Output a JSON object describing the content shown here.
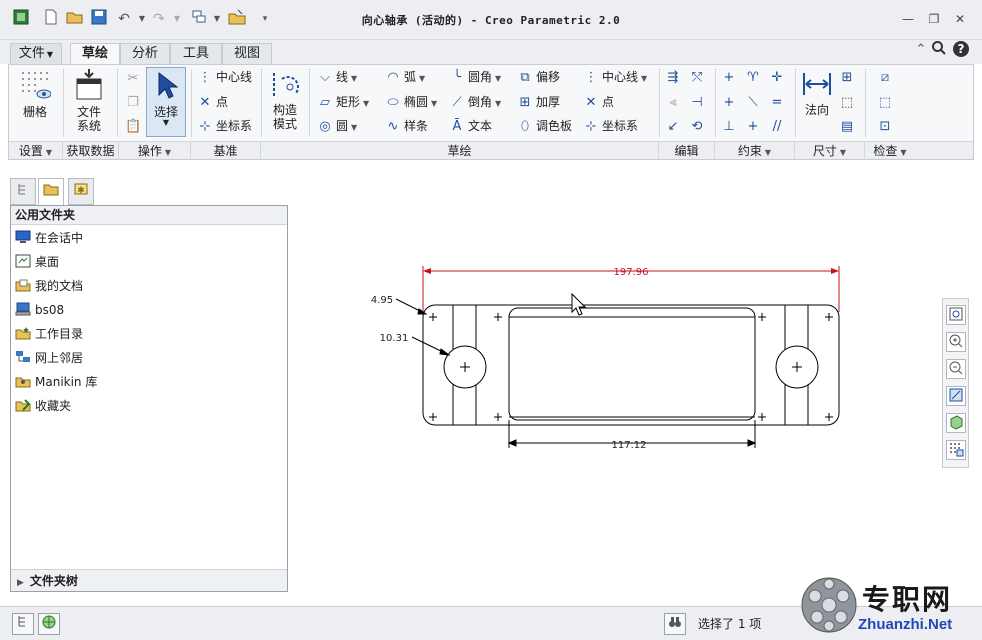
{
  "window": {
    "title": "向心轴承 (活动的) - Creo Parametric 2.0"
  },
  "tabs": [
    {
      "label": "文件",
      "active": false
    },
    {
      "label": "草绘",
      "active": true
    },
    {
      "label": "分析",
      "active": false
    },
    {
      "label": "工具",
      "active": false
    },
    {
      "label": "视图",
      "active": false
    }
  ],
  "ribbon": {
    "grid_label": "栅格",
    "file_system_label": "文件\n系统",
    "select_label": "选择",
    "datum": {
      "centerline": "中心线",
      "point": "点",
      "coordsys": "坐标系"
    },
    "construction_label": "构造\n模式",
    "sketch": {
      "line": "线",
      "rectangle": "矩形",
      "circle": "圆",
      "arc": "弧",
      "ellipse": "椭圆",
      "spline": "样条",
      "fillet": "圆角",
      "chamfer": "倒角",
      "text": "文本",
      "offset": "偏移",
      "thicken": "加厚",
      "palette": "调色板",
      "centerline": "中心线",
      "point": "点",
      "coordsys": "坐标系"
    },
    "normal_label": "法向",
    "groups": {
      "setup": "设置",
      "get_data": "获取数据",
      "operations": "操作",
      "datum": "基准",
      "sketching": "草绘",
      "editing": "编辑",
      "constrain": "约束",
      "dimension": "尺寸",
      "inspect": "检查"
    }
  },
  "navigator": {
    "header": "公用文件夹",
    "folders": [
      {
        "label": "在会话中",
        "icon": "monitor-icon"
      },
      {
        "label": "桌面",
        "icon": "desktop-icon"
      },
      {
        "label": "我的文档",
        "icon": "documents-icon"
      },
      {
        "label": "bs08",
        "icon": "computer-icon"
      },
      {
        "label": "工作目录",
        "icon": "working-dir-icon"
      },
      {
        "label": "网上邻居",
        "icon": "network-icon"
      },
      {
        "label": "Manikin 库",
        "icon": "manikin-icon"
      },
      {
        "label": "收藏夹",
        "icon": "favorites-icon"
      }
    ],
    "folder_tree": "文件夹树"
  },
  "drawing": {
    "dims": {
      "overall_width": "197.96",
      "corner_radius": "4.95",
      "hole_dia": "10.31",
      "slot_width": "117.12"
    }
  },
  "status": {
    "selection": "选择了 1 项"
  },
  "watermark": {
    "cn": "专职网",
    "en": "Zhuanzhi.Net"
  },
  "colors": {
    "ribbon_icon": "#1f4e9e",
    "dimension_red": "#c0141c",
    "geometry": "#000000"
  }
}
